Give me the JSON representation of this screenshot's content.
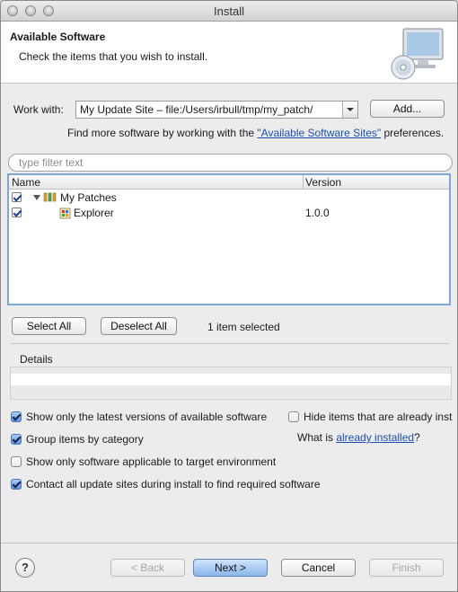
{
  "window": {
    "title": "Install"
  },
  "banner": {
    "title": "Available Software",
    "subtitle": "Check the items that you wish to install.",
    "icon": "computer-cd-icon"
  },
  "work_with": {
    "label": "Work with:",
    "value": "My Update Site – file:/Users/irbull/tmp/my_patch/",
    "add_label": "Add..."
  },
  "find_more": {
    "prefix": "Find more software by working with the ",
    "link": "\"Available Software Sites\"",
    "suffix": " preferences."
  },
  "filter": {
    "placeholder": "type filter text"
  },
  "tree": {
    "columns": [
      "Name",
      "Version"
    ],
    "rows": [
      {
        "name": "My Patches",
        "version": "",
        "checked": true,
        "icon": "category-icon"
      },
      {
        "name": "Explorer",
        "version": "1.0.0",
        "checked": true,
        "icon": "feature-icon"
      }
    ]
  },
  "selection": {
    "select_all": "Select All",
    "deselect_all": "Deselect All",
    "status": "1 item selected"
  },
  "details": {
    "label": "Details"
  },
  "options": {
    "latest_versions": "Show only the latest versions of available software",
    "hide_installed": "Hide items that are already inst",
    "group_by_category": "Group items by category",
    "what_is_prefix": "What is ",
    "what_is_link": "already installed",
    "what_is_suffix": "?",
    "target_env": "Show only software applicable to target environment",
    "contact_sites": "Contact all update sites during install to find required software"
  },
  "footer": {
    "help": "?",
    "back": "< Back",
    "next": "Next >",
    "cancel": "Cancel",
    "finish": "Finish"
  }
}
